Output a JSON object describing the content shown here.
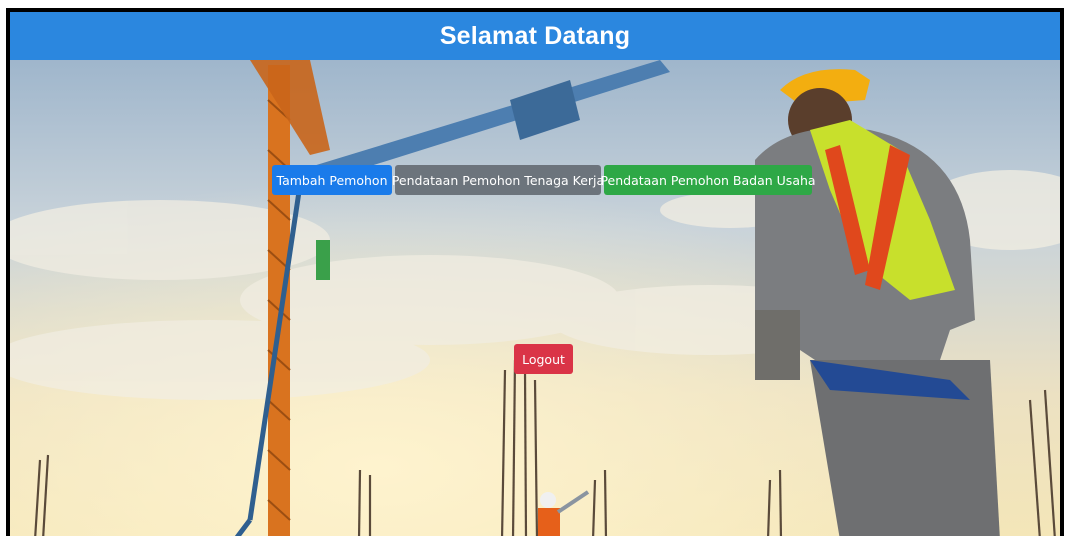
{
  "header": {
    "title": "Selamat Datang"
  },
  "actions": {
    "add_applicant": "Tambah Pemohon",
    "worker_registration": "Pendataan Pemohon Tenaga Kerja",
    "business_registration": "Pendataan Pemohon Badan Usaha"
  },
  "logout": {
    "label": "Logout"
  },
  "colors": {
    "header": "#2b87df",
    "primary": "#1a7bea",
    "secondary": "#6c747c",
    "success": "#2ea846",
    "danger": "#da3447"
  },
  "background": {
    "image": "construction site with crane and workers at sunrise"
  }
}
